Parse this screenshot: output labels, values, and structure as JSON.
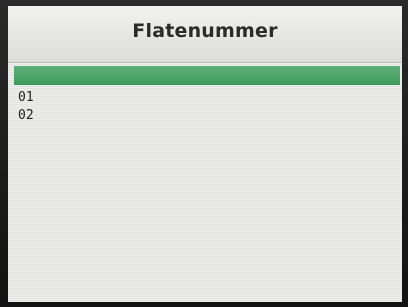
{
  "screen": {
    "title": "Flatenummer",
    "highlight_color": "#4aa366",
    "items": [
      {
        "label": ""
      },
      {
        "label": "01"
      },
      {
        "label": "02"
      }
    ]
  }
}
